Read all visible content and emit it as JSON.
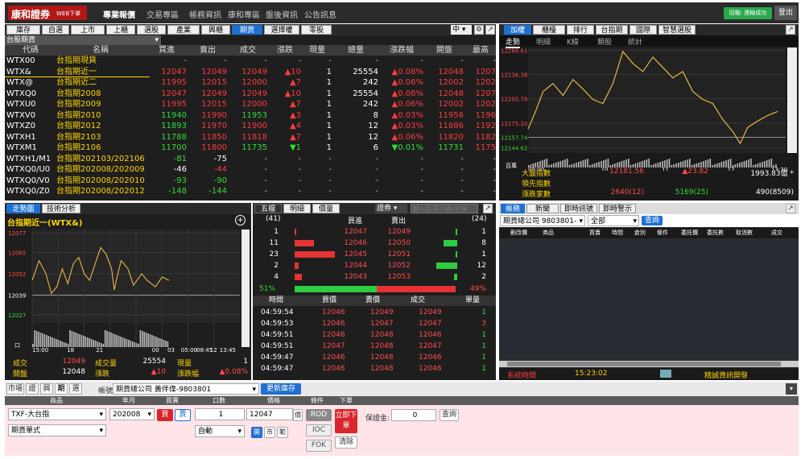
{
  "header": {
    "logo": "康和證券",
    "logo_sub": "WEB下單",
    "nav": [
      "專業報價",
      "交易專區",
      "帳務資訊",
      "康和專區",
      "盤後資訊",
      "公告訊息"
    ],
    "status": "回報: 連線成功",
    "logout": "登出"
  },
  "quote_panel": {
    "tabs": [
      "庫存",
      "自選",
      "上市",
      "上櫃",
      "選股",
      "產業",
      "興櫃",
      "期貨",
      "選擇權",
      "零股"
    ],
    "active_tab": "期貨",
    "zoom": "中",
    "category_select": "台股期貨",
    "columns": [
      "代碼",
      "名稱",
      "買進",
      "賣出",
      "成交",
      "漲跌",
      "現量",
      "總量",
      "漲跌幅",
      "開盤",
      "最高"
    ],
    "rows": [
      {
        "code": "WTX00",
        "name": "台指期現貨",
        "bid": "-",
        "ask": "-",
        "last": "-",
        "chg": "-",
        "vol": "-",
        "total": "-",
        "pct": "-",
        "open": "-",
        "high": "-"
      },
      {
        "code": "WTX&",
        "name": "台指期近一",
        "bid": "12047",
        "ask": "12049",
        "last": "12049",
        "chg": "▲10",
        "vol": "1",
        "total": "25554",
        "pct": "▲0.08%",
        "open": "12048",
        "high": "1207"
      },
      {
        "code": "WTX@",
        "name": "台指期近二",
        "bid": "11995",
        "ask": "12015",
        "last": "12000",
        "chg": "▲7",
        "vol": "1",
        "total": "242",
        "pct": "▲0.06%",
        "open": "12002",
        "high": "1202"
      },
      {
        "code": "WTXQ0",
        "name": "台指期2008",
        "bid": "12047",
        "ask": "12049",
        "last": "12049",
        "chg": "▲10",
        "vol": "1",
        "total": "25554",
        "pct": "▲0.08%",
        "open": "12048",
        "high": "1207"
      },
      {
        "code": "WTXU0",
        "name": "台指期2009",
        "bid": "11995",
        "ask": "12015",
        "last": "12000",
        "chg": "▲7",
        "vol": "1",
        "total": "242",
        "pct": "▲0.06%",
        "open": "12002",
        "high": "1202"
      },
      {
        "code": "WTXV0",
        "name": "台指期2010",
        "bid": "11940",
        "ask": "11990",
        "last": "11953",
        "chg": "▲3",
        "vol": "1",
        "total": "8",
        "pct": "▲0.03%",
        "open": "11956",
        "high": "1196"
      },
      {
        "code": "WTXZ0",
        "name": "台指期2012",
        "bid": "11893",
        "ask": "11970",
        "last": "11900",
        "chg": "▲4",
        "vol": "1",
        "total": "12",
        "pct": "▲0.03%",
        "open": "11886",
        "high": "1192"
      },
      {
        "code": "WTXH1",
        "name": "台指期2103",
        "bid": "11788",
        "ask": "11850",
        "last": "11818",
        "chg": "▲7",
        "vol": "1",
        "total": "12",
        "pct": "▲0.06%",
        "open": "11820",
        "high": "1182"
      },
      {
        "code": "WTXM1",
        "name": "台指期2106",
        "bid": "11700",
        "ask": "11800",
        "last": "11735",
        "chg": "▼1",
        "vol": "1",
        "total": "6",
        "pct": "▼0.01%",
        "open": "11731",
        "high": "1175"
      },
      {
        "code": "WTXH1/M1",
        "name": "台指期202103/202106",
        "bid": "-81",
        "ask": "-75",
        "last": "-",
        "chg": "-",
        "vol": "-",
        "total": "-",
        "pct": "-",
        "open": "-",
        "high": "-"
      },
      {
        "code": "WTXQ0/U0",
        "name": "台指期202008/202009",
        "bid": "-46",
        "ask": "-44",
        "last": "-",
        "chg": "-",
        "vol": "-",
        "total": "-",
        "pct": "-",
        "open": "-",
        "high": "-"
      },
      {
        "code": "WTXQ0/V0",
        "name": "台指期202008/202010",
        "bid": "-93",
        "ask": "-90",
        "last": "-",
        "chg": "-",
        "vol": "-",
        "total": "-",
        "pct": "-",
        "open": "-",
        "high": "-"
      },
      {
        "code": "WTXQ0/Z0",
        "name": "台指期202008/202012",
        "bid": "-148",
        "ask": "-144",
        "last": "-",
        "chg": "-",
        "vol": "-",
        "total": "-",
        "pct": "-",
        "open": "-",
        "high": "-"
      }
    ]
  },
  "index_panel": {
    "tabs": [
      "加權",
      "櫃檯",
      "排行",
      "台指期",
      "國際",
      "智慧選股"
    ],
    "subtabs": [
      "走勢",
      "明細",
      "K線",
      "類股",
      "統計"
    ],
    "ylabels": [
      "12266.61",
      "12236.38",
      "12205.78",
      "12175.20",
      "12157.74",
      "12144.62"
    ],
    "xlabels": [
      "09:00",
      "10",
      "11",
      "12",
      "13:30"
    ],
    "vol_label": "百萬",
    "stats": [
      {
        "label": "大盤指數",
        "a": "12181.56",
        "b": "▲23.82",
        "c": "1993.83億 *"
      },
      {
        "label": "領先指數",
        "a": "",
        "b": "",
        "c": ""
      },
      {
        "label": "漲跌家數",
        "a": "2640(12)",
        "b": "5169(25)",
        "c": "490(8509)"
      }
    ]
  },
  "trend_panel": {
    "tabs": [
      "走勢圖",
      "技術分析"
    ],
    "title": "台指期近一(WTX&)",
    "ylabels": [
      "12077",
      "12065",
      "12052",
      "12039",
      "12027"
    ],
    "xlabels": [
      "15:00",
      "18",
      "21",
      "00",
      "03",
      "05:00",
      "08:45",
      "12",
      "13:45"
    ],
    "vol_label": "口",
    "info": [
      {
        "k1": "成交",
        "v1": "12049",
        "k2": "成交量",
        "v2": "25554",
        "k3": "現量",
        "v3": "1"
      },
      {
        "k1": "開盤",
        "v1": "12048",
        "k2": "漲跌",
        "v2": "▲10",
        "k3": "漲跌幅",
        "v3": "▲0.08%"
      }
    ]
  },
  "depth_panel": {
    "tabs": [
      "五檔",
      "明細",
      "價量"
    ],
    "security_select": "證券",
    "search_placeholder": "輸入股票代碼/名稱",
    "bid_total": "(41)",
    "ask_total": "(24)",
    "bid_label": "買進",
    "ask_label": "賣出",
    "levels": [
      {
        "bq": "1",
        "bp": "12047",
        "ap": "12049",
        "aq": "1",
        "bw": 0.02,
        "aw": 0.02
      },
      {
        "bq": "11",
        "bp": "12046",
        "ap": "12050",
        "aq": "8",
        "bw": 0.48,
        "aw": 0.35
      },
      {
        "bq": "23",
        "bp": "12045",
        "ap": "12051",
        "aq": "1",
        "bw": 1.0,
        "aw": 0.05
      },
      {
        "bq": "2",
        "bp": "12044",
        "ap": "12052",
        "aq": "12",
        "bw": 0.09,
        "aw": 0.52
      },
      {
        "bq": "4",
        "bp": "12043",
        "ap": "12053",
        "aq": "2",
        "bw": 0.17,
        "aw": 0.09
      }
    ],
    "bid_pct": "51%",
    "ask_pct": "49%",
    "bid_ratio": 0.51,
    "tick_cols": [
      "時間",
      "買價",
      "賣價",
      "成交",
      "單量"
    ],
    "ticks": [
      {
        "t": "04:59:54",
        "b": "12046",
        "a": "12049",
        "p": "12049",
        "q": "1"
      },
      {
        "t": "04:59:53",
        "b": "12046",
        "a": "12047",
        "p": "12047",
        "q": "3"
      },
      {
        "t": "04:59:51",
        "b": "12046",
        "a": "12048",
        "p": "12046",
        "q": "1"
      },
      {
        "t": "04:59:51",
        "b": "12047",
        "a": "12048",
        "p": "12047",
        "q": "1"
      },
      {
        "t": "04:59:47",
        "b": "12046",
        "a": "12048",
        "p": "12046",
        "q": "1"
      },
      {
        "t": "04:59:47",
        "b": "12046",
        "a": "12048",
        "p": "12046",
        "q": "1"
      }
    ]
  },
  "account_panel": {
    "tabs": [
      "帳務",
      "新聞",
      "即時訊號",
      "即時警示"
    ],
    "account_select": "期貨總公司 9803801-",
    "filter_select": "全部",
    "query": "查詢",
    "columns": [
      "刪改價",
      "商品",
      "買賣",
      "時間",
      "倉別",
      "條件",
      "委託價",
      "委託數",
      "取消數",
      "成交"
    ],
    "sys_time_label": "系統時間",
    "sys_time": "15:23:02",
    "vendor": "精誠資訊開發"
  },
  "order_panel": {
    "tabs": [
      "市場",
      "證",
      "興",
      "期",
      "選"
    ],
    "account_label": "帳號",
    "account": "期貨總公司 黃伴偉-9803801",
    "refresh": "更新庫存",
    "labels": [
      "商品",
      "年月",
      "買賣",
      "口數",
      "價格",
      "條件",
      "下單"
    ],
    "product": "TXF-大台指",
    "month": "202008",
    "buy": "買",
    "sell": "賣",
    "qty": "1",
    "price": "12047",
    "price_unit": "價",
    "cond1": "ROD",
    "cond2": "IOC",
    "cond3": "FOK",
    "place": "立即下單",
    "type": "期貨單式",
    "auto": "自動",
    "oc": [
      "開",
      "市",
      "範"
    ],
    "clear": "清除",
    "margin_label": "保證金:",
    "margin": "0",
    "query": "查詢"
  }
}
